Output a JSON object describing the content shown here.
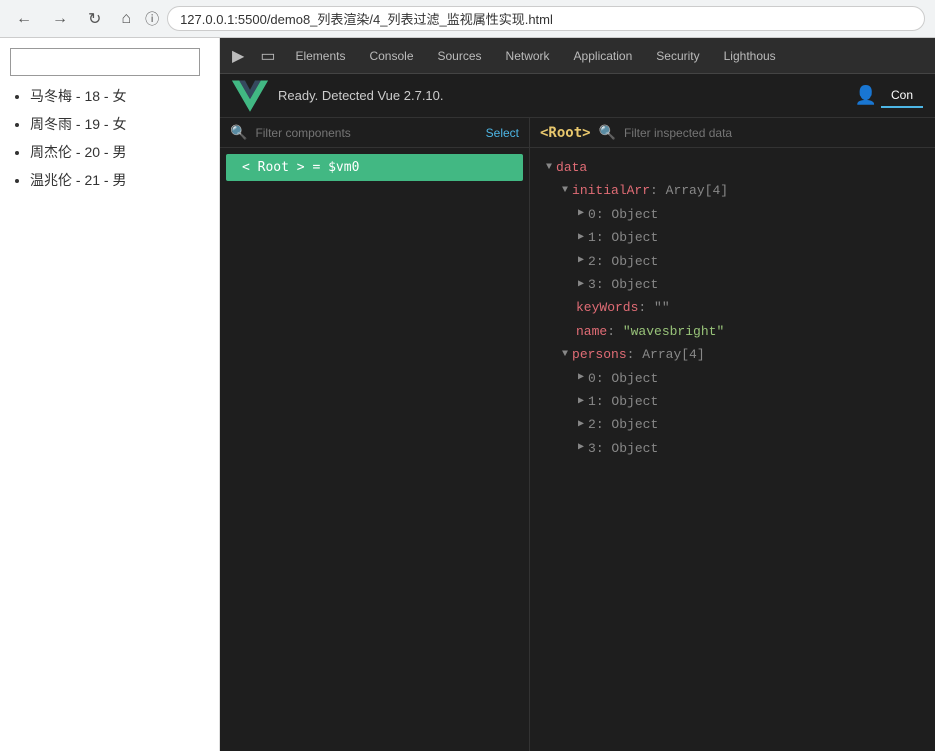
{
  "browser": {
    "url": "127.0.0.1:5500/demo8_列表渲染/4_列表过滤_监视属性实现.html",
    "back_icon": "←",
    "forward_icon": "→",
    "home_icon": "⌂",
    "info_icon": "ℹ"
  },
  "webpage": {
    "search_placeholder": "",
    "persons": [
      {
        "name": "马冬梅",
        "age": "18",
        "gender": "女"
      },
      {
        "name": "周冬雨",
        "age": "19",
        "gender": "女"
      },
      {
        "name": "周杰伦",
        "age": "20",
        "gender": "男"
      },
      {
        "name": "温兆伦",
        "age": "21",
        "gender": "男"
      }
    ]
  },
  "devtools": {
    "tabs": [
      {
        "label": "Elements",
        "active": false
      },
      {
        "label": "Console",
        "active": false
      },
      {
        "label": "Sources",
        "active": false
      },
      {
        "label": "Network",
        "active": false
      },
      {
        "label": "Application",
        "active": false
      },
      {
        "label": "Security",
        "active": false
      },
      {
        "label": "Lighthous",
        "active": false
      }
    ],
    "vue_header": {
      "ready_text": "Ready. Detected Vue 2.7.10.",
      "con_tab": "Con"
    },
    "component_tree": {
      "filter_placeholder": "Filter components",
      "select_label": "Select",
      "root_item": "< Root > = $vm0"
    },
    "data_panel": {
      "root_label": "<Root>",
      "filter_placeholder": "Filter inspected data",
      "tree": {
        "data_label": "data",
        "initialArr_label": "initialArr",
        "initialArr_type": "Array[4]",
        "initialArr_items": [
          "0: Object",
          "1: Object",
          "2: Object",
          "3: Object"
        ],
        "keyWords_label": "keyWords",
        "keyWords_value": "\"\"",
        "name_label": "name",
        "name_value": "\"wavesbright\"",
        "persons_label": "persons",
        "persons_type": "Array[4]",
        "persons_items": [
          "0: Object",
          "1: Object",
          "2: Object",
          "3: Object"
        ]
      }
    }
  }
}
